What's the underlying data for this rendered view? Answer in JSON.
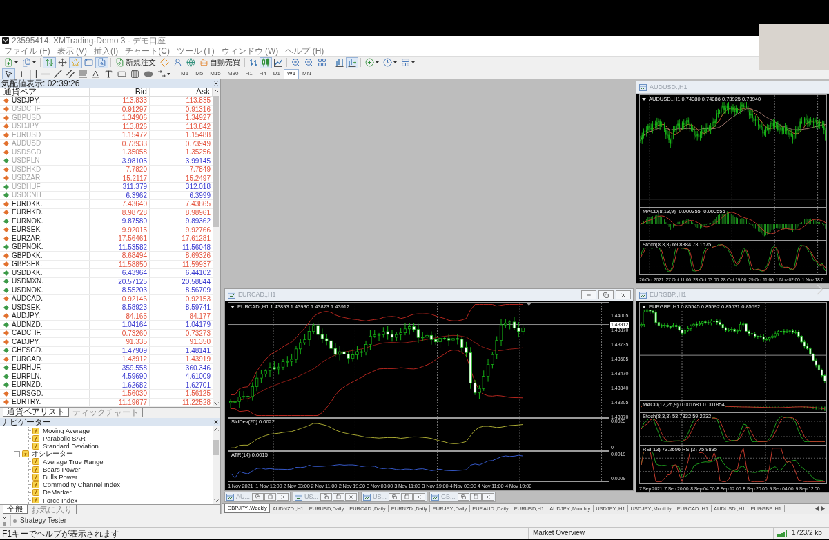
{
  "window": {
    "title": "23595414: XMTrading-Demo 3 - デモ口座"
  },
  "menu": [
    "ファイル (F)",
    "表示 (V)",
    "挿入(I)",
    "チャート(C)",
    "ツール (T)",
    "ウィンドウ (W)",
    "ヘルプ (H)"
  ],
  "toolbar": {
    "items": [
      {
        "kind": "new_chart",
        "pressed": false
      },
      {
        "kind": "profiles",
        "pressed": false
      },
      {
        "kind": "separator"
      },
      {
        "kind": "market_watch",
        "pressed": true
      },
      {
        "kind": "data_window",
        "pressed": false
      },
      {
        "kind": "navigator",
        "pressed": true
      },
      {
        "kind": "terminal",
        "pressed": false
      },
      {
        "kind": "tester",
        "pressed": true
      },
      {
        "kind": "separator"
      },
      {
        "kind": "new_order",
        "label": "新規注文",
        "pressed": false
      },
      {
        "kind": "meta_editor",
        "pressed": false
      },
      {
        "kind": "community",
        "pressed": false
      },
      {
        "kind": "signals",
        "pressed": false
      },
      {
        "kind": "auto_trading",
        "label": "自動売買",
        "pressed": false
      },
      {
        "kind": "separator"
      },
      {
        "kind": "bar_chart",
        "pressed": false
      },
      {
        "kind": "candles",
        "pressed": true
      },
      {
        "kind": "line_chart",
        "pressed": false
      },
      {
        "kind": "separator"
      },
      {
        "kind": "zoom_in",
        "pressed": false
      },
      {
        "kind": "zoom_out",
        "pressed": false
      },
      {
        "kind": "tile",
        "pressed": false
      },
      {
        "kind": "separator"
      },
      {
        "kind": "chart_shift",
        "pressed": false
      },
      {
        "kind": "auto_scroll",
        "pressed": true
      },
      {
        "kind": "separator"
      },
      {
        "kind": "indicators",
        "pressed": false
      },
      {
        "kind": "periods",
        "pressed": false
      },
      {
        "kind": "templates",
        "pressed": false
      }
    ]
  },
  "drawing_toolbar": {
    "items": [
      {
        "kind": "cursor",
        "pressed": true
      },
      {
        "kind": "crosshair",
        "pressed": false
      },
      {
        "kind": "separator"
      },
      {
        "kind": "vertical_line",
        "pressed": false
      },
      {
        "kind": "horizontal_line",
        "pressed": false
      },
      {
        "kind": "trend_line",
        "pressed": false
      },
      {
        "kind": "channel",
        "pressed": false
      },
      {
        "kind": "fibonacci",
        "pressed": false
      },
      {
        "kind": "text",
        "pressed": false
      },
      {
        "kind": "text_label",
        "pressed": false
      },
      {
        "kind": "rectangle",
        "pressed": false
      },
      {
        "kind": "cycle_lines",
        "pressed": false
      },
      {
        "kind": "ellipse",
        "pressed": false
      },
      {
        "kind": "arrows",
        "pressed": false
      },
      {
        "kind": "separator"
      }
    ],
    "timeframes": [
      {
        "label": "M1",
        "selected": false
      },
      {
        "label": "M5",
        "selected": false
      },
      {
        "label": "M15",
        "selected": false
      },
      {
        "label": "M30",
        "selected": false
      },
      {
        "label": "H1",
        "selected": false
      },
      {
        "label": "H4",
        "selected": false
      },
      {
        "label": "D1",
        "selected": false
      },
      {
        "label": "W1",
        "selected": true
      },
      {
        "label": "MN",
        "selected": false
      }
    ]
  },
  "market_watch": {
    "title": "気配値表示: 02:39:26",
    "columns": [
      "通貨ペア",
      "Bid",
      "Ask"
    ],
    "rows": [
      {
        "symbol": "USDJPY.",
        "bid": "113.833",
        "ask": "113.835",
        "rising": false,
        "dimmed": false
      },
      {
        "symbol": "USDCHF",
        "bid": "0.91297",
        "ask": "0.91316",
        "rising": false,
        "dimmed": true
      },
      {
        "symbol": "GBPUSD",
        "bid": "1.34906",
        "ask": "1.34927",
        "rising": false,
        "dimmed": true
      },
      {
        "symbol": "USDJPY",
        "bid": "113.826",
        "ask": "113.842",
        "rising": false,
        "dimmed": true
      },
      {
        "symbol": "EURUSD",
        "bid": "1.15472",
        "ask": "1.15488",
        "rising": false,
        "dimmed": true
      },
      {
        "symbol": "AUDUSD",
        "bid": "0.73933",
        "ask": "0.73949",
        "rising": false,
        "dimmed": true
      },
      {
        "symbol": "USDSGD",
        "bid": "1.35058",
        "ask": "1.35256",
        "rising": false,
        "dimmed": true
      },
      {
        "symbol": "USDPLN",
        "bid": "3.98105",
        "ask": "3.99145",
        "rising": true,
        "dimmed": true
      },
      {
        "symbol": "USDHKD",
        "bid": "7.7820",
        "ask": "7.7849",
        "rising": false,
        "dimmed": true
      },
      {
        "symbol": "USDZAR",
        "bid": "15.2117",
        "ask": "15.2497",
        "rising": false,
        "dimmed": true
      },
      {
        "symbol": "USDHUF",
        "bid": "311.379",
        "ask": "312.018",
        "rising": true,
        "dimmed": true
      },
      {
        "symbol": "USDCNH",
        "bid": "6.3962",
        "ask": "6.3999",
        "rising": true,
        "dimmed": true
      },
      {
        "symbol": "EURDKK.",
        "bid": "7.43640",
        "ask": "7.43865",
        "rising": false,
        "dimmed": false
      },
      {
        "symbol": "EURHKD.",
        "bid": "8.98728",
        "ask": "8.98961",
        "rising": false,
        "dimmed": false
      },
      {
        "symbol": "EURNOK.",
        "bid": "9.87580",
        "ask": "9.89362",
        "rising": true,
        "dimmed": false
      },
      {
        "symbol": "EURSEK.",
        "bid": "9.92015",
        "ask": "9.92766",
        "rising": false,
        "dimmed": false
      },
      {
        "symbol": "EURZAR.",
        "bid": "17.56461",
        "ask": "17.61281",
        "rising": false,
        "dimmed": false
      },
      {
        "symbol": "GBPNOK.",
        "bid": "11.53582",
        "ask": "11.56048",
        "rising": true,
        "dimmed": false
      },
      {
        "symbol": "GBPDKK.",
        "bid": "8.68494",
        "ask": "8.69326",
        "rising": false,
        "dimmed": false
      },
      {
        "symbol": "GBPSEK.",
        "bid": "11.58850",
        "ask": "11.59937",
        "rising": false,
        "dimmed": false
      },
      {
        "symbol": "USDDKK.",
        "bid": "6.43964",
        "ask": "6.44102",
        "rising": true,
        "dimmed": false
      },
      {
        "symbol": "USDMXN.",
        "bid": "20.57125",
        "ask": "20.58844",
        "rising": true,
        "dimmed": false
      },
      {
        "symbol": "USDNOK.",
        "bid": "8.55203",
        "ask": "8.56709",
        "rising": true,
        "dimmed": false
      },
      {
        "symbol": "AUDCAD.",
        "bid": "0.92146",
        "ask": "0.92153",
        "rising": false,
        "dimmed": false
      },
      {
        "symbol": "USDSEK.",
        "bid": "8.58923",
        "ask": "8.59741",
        "rising": true,
        "dimmed": false
      },
      {
        "symbol": "AUDJPY.",
        "bid": "84.165",
        "ask": "84.177",
        "rising": false,
        "dimmed": false
      },
      {
        "symbol": "AUDNZD.",
        "bid": "1.04164",
        "ask": "1.04179",
        "rising": true,
        "dimmed": false
      },
      {
        "symbol": "CADCHF.",
        "bid": "0.73260",
        "ask": "0.73273",
        "rising": false,
        "dimmed": false
      },
      {
        "symbol": "CADJPY.",
        "bid": "91.335",
        "ask": "91.350",
        "rising": false,
        "dimmed": false
      },
      {
        "symbol": "CHFSGD.",
        "bid": "1.47909",
        "ask": "1.48141",
        "rising": true,
        "dimmed": false
      },
      {
        "symbol": "EURCAD.",
        "bid": "1.43912",
        "ask": "1.43919",
        "rising": false,
        "dimmed": false
      },
      {
        "symbol": "EURHUF.",
        "bid": "359.558",
        "ask": "360.346",
        "rising": true,
        "dimmed": false
      },
      {
        "symbol": "EURPLN.",
        "bid": "4.59690",
        "ask": "4.61009",
        "rising": true,
        "dimmed": false
      },
      {
        "symbol": "EURNZD.",
        "bid": "1.62682",
        "ask": "1.62701",
        "rising": true,
        "dimmed": false
      },
      {
        "symbol": "EURSGD.",
        "bid": "1.56030",
        "ask": "1.56125",
        "rising": false,
        "dimmed": false
      },
      {
        "symbol": "EURTRY.",
        "bid": "11.19677",
        "ask": "11.22528",
        "rising": false,
        "dimmed": false
      }
    ],
    "tabs": [
      {
        "label": "通貨ペアリスト",
        "selected": true
      },
      {
        "label": "ティックチャート",
        "selected": false
      }
    ]
  },
  "navigator": {
    "title": "ナビゲーター",
    "tree": [
      {
        "children": [
          {
            "label": "Moving Average"
          },
          {
            "label": "Parabolic SAR"
          },
          {
            "label": "Standard Deviation"
          }
        ]
      },
      {
        "label": "オシレーター",
        "expanded": true,
        "children": [
          {
            "label": "Average True Range"
          },
          {
            "label": "Bears Power"
          },
          {
            "label": "Bulls Power"
          },
          {
            "label": "Commodity Channel Index"
          },
          {
            "label": "DeMarker"
          },
          {
            "label": "Force Index"
          }
        ]
      }
    ],
    "tabs": [
      {
        "label": "全般",
        "selected": true
      },
      {
        "label": "お気に入り",
        "selected": false
      }
    ]
  },
  "chart_windows": [
    {
      "title": "AUDUSD.,H1",
      "legend": "AUDUSD.,H1 0.74080 0.74086 0.73925 0.73940",
      "panes": [
        {
          "kind": "macd",
          "label": "MACD(8,13,9) -0.000355 -0.000555"
        },
        {
          "kind": "stoch",
          "label": "Stoch(8,3,3) 69.8384 73.1675"
        }
      ],
      "time_labels": [
        "26 Oct 2021",
        "27 Oct 11:00",
        "28 Oct 03:00",
        "28 Oct 19:00",
        "29 Oct 11:00",
        "1 Nov 02:00",
        "1 Nov 18:0"
      ]
    },
    {
      "title": "EURCAD.,H1",
      "legend": "EURCAD.,H1 1.43893 1.43930 1.43873 1.43912",
      "price_ticks": [
        "1.44005",
        "1.43870",
        "1.43735",
        "1.43605",
        "1.43470",
        "1.43340",
        "1.43205",
        "1.43070"
      ],
      "current_price": "1.43912",
      "panes": [
        {
          "kind": "stddev",
          "label": "StdDev(20) 0.0022",
          "ticks": [
            "0.0023",
            "0"
          ]
        },
        {
          "kind": "atr",
          "label": "ATR(14) 0.0015",
          "ticks": [
            "0.0019",
            "0.0009"
          ]
        }
      ],
      "time_labels": [
        "1 Nov 2021",
        "1 Nov 19:00",
        "2 Nov 03:00",
        "2 Nov 11:00",
        "2 Nov 19:00",
        "3 Nov 03:00",
        "3 Nov 11:00",
        "3 Nov 19:00",
        "4 Nov 03:00",
        "4 Nov 11:00",
        "4 Nov 19:00"
      ]
    },
    {
      "title": "EURGBP.,H1",
      "legend": "EURGBP.,H1 0.85545 0.85592 0.85531 0.85592",
      "panes": [
        {
          "kind": "macd",
          "label": "MACD(12,26,9) 0.001681 0.001854"
        },
        {
          "kind": "stoch",
          "label": "Stoch(8,3,3) 53.7832 59.2232"
        },
        {
          "kind": "rsi",
          "label": "RSI(13) 73.2696  RSI(3) 75.9835"
        }
      ],
      "time_labels": [
        "7 Sep 2021",
        "7 Sep 20:00",
        "8 Sep 04:00",
        "8 Sep 12:00",
        "8 Sep 20:00",
        "9 Sep 04:00",
        "9 Sep 12:00"
      ]
    }
  ],
  "minimized_windows": [
    {
      "title": "AU..."
    },
    {
      "title": "US..."
    },
    {
      "title": "US..."
    },
    {
      "title": "GB..."
    }
  ],
  "chart_tabs": [
    {
      "label": "GBPJPY.,Weekly",
      "selected": true
    },
    {
      "label": "AUDNZD.,H1",
      "selected": false
    },
    {
      "label": "EURUSD,Daily",
      "selected": false
    },
    {
      "label": "EURCAD.,Daily",
      "selected": false
    },
    {
      "label": "EURNZD.,Daily",
      "selected": false
    },
    {
      "label": "EURJPY.,Daily",
      "selected": false
    },
    {
      "label": "EURAUD.,Daily",
      "selected": false
    },
    {
      "label": "EURUSD,H1",
      "selected": false
    },
    {
      "label": "AUDJPY.,Monthly",
      "selected": false
    },
    {
      "label": "USDJPY.,H1",
      "selected": false
    },
    {
      "label": "USDJPY.,Monthly",
      "selected": false
    },
    {
      "label": "EURCAD.,H1",
      "selected": false
    },
    {
      "label": "AUDUSD.,H1",
      "selected": false
    },
    {
      "label": "EURGBP.,H1",
      "selected": false
    }
  ],
  "strategy_tester": {
    "title": "Strategy Tester"
  },
  "status_bar": {
    "help": "F1キーでヘルプが表示されます",
    "profile": "Market Overview",
    "traffic": "1723/2 kb"
  }
}
